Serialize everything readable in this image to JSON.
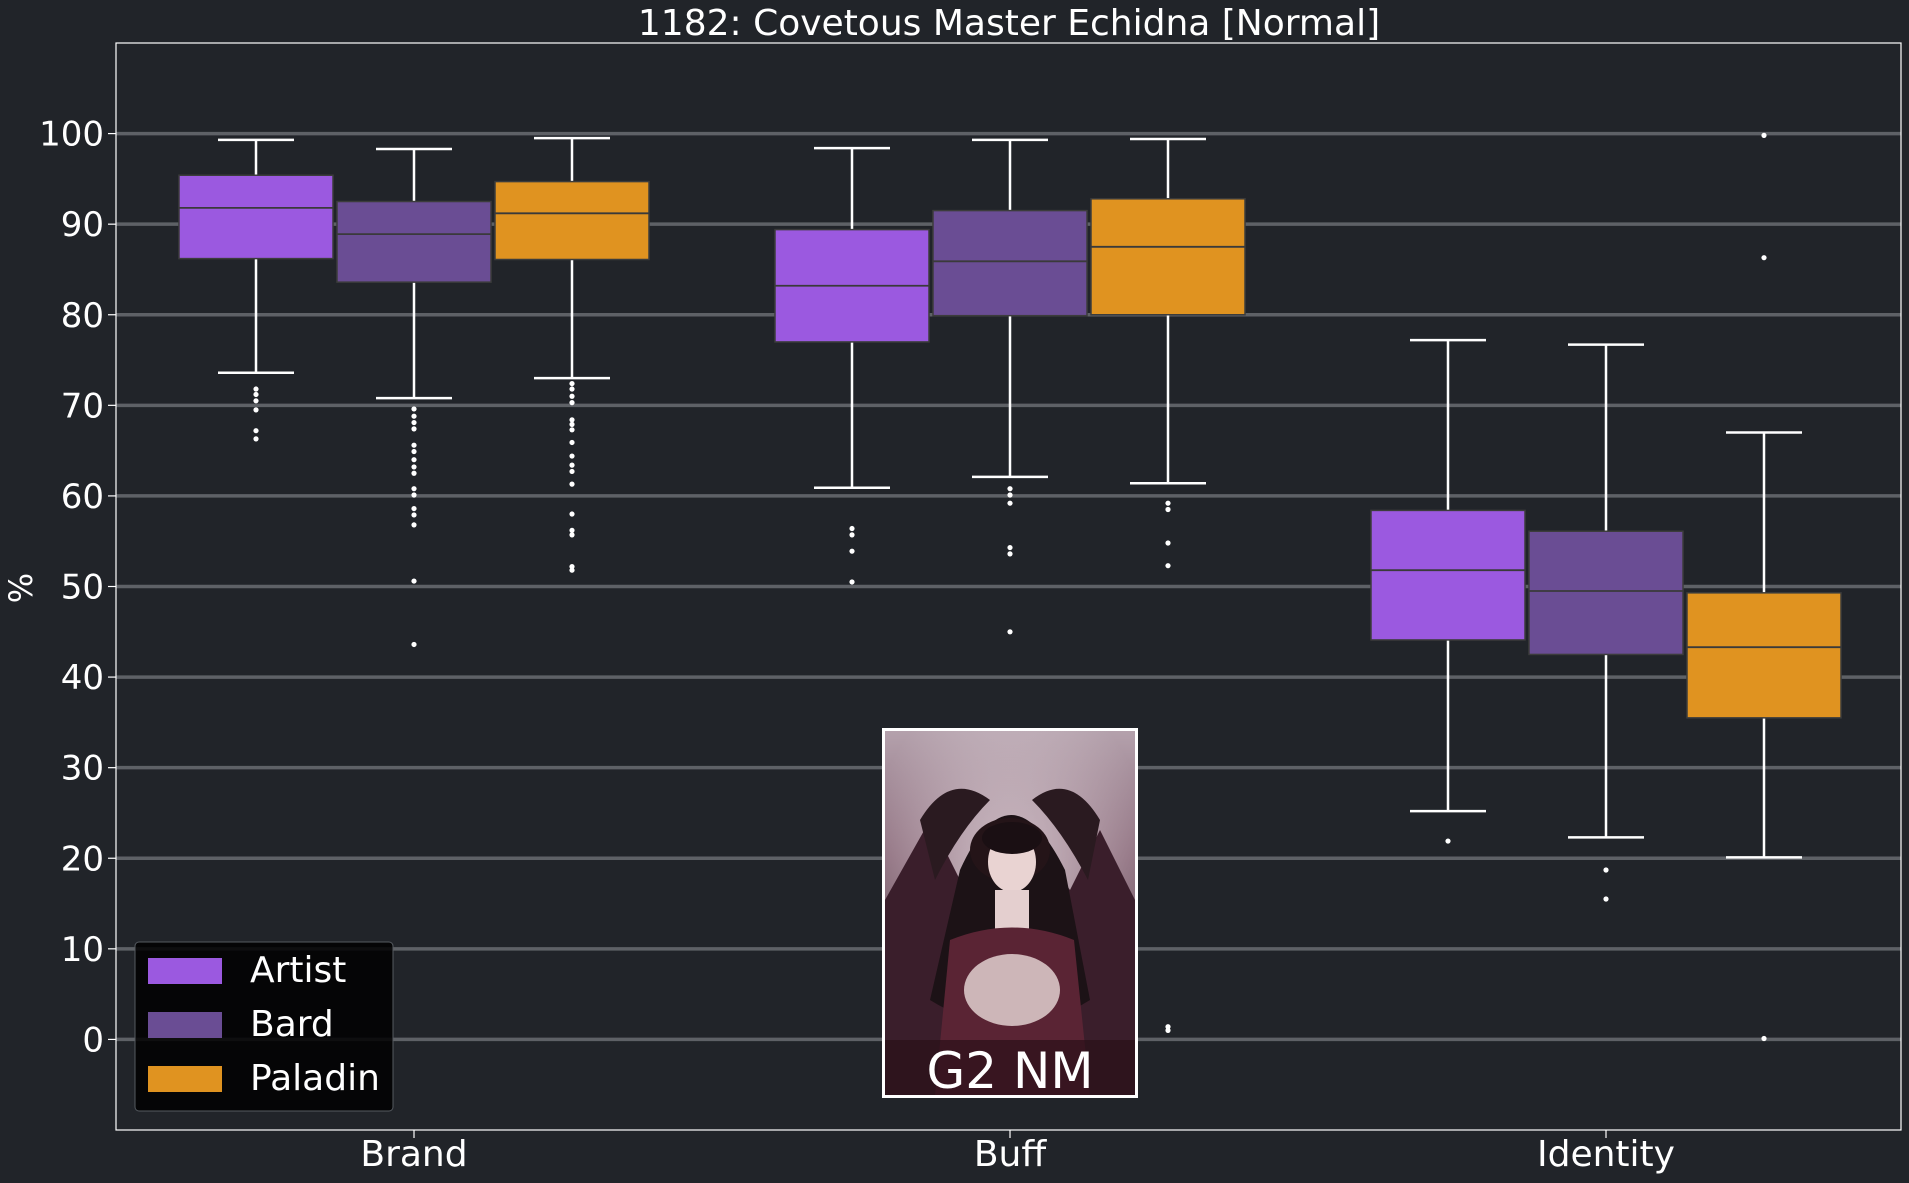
{
  "chart_data": {
    "type": "box",
    "title": "1182: Covetous Master Echidna [Normal]",
    "xlabel": "",
    "ylabel": "%",
    "ylim": [
      -10,
      110
    ],
    "yticks": [
      0,
      10,
      20,
      30,
      40,
      50,
      60,
      70,
      80,
      90,
      100
    ],
    "categories": [
      "Brand",
      "Buff",
      "Identity"
    ],
    "grid": "horizontal",
    "legend_position": "bottom-left",
    "series": [
      {
        "name": "Artist",
        "color": "#9b59e0",
        "boxes": [
          {
            "whisker_low": 73.6,
            "q1": 86.2,
            "median": 91.8,
            "q3": 95.4,
            "whisker_high": 99.3,
            "outliers": [
              71.8,
              71.2,
              70.5,
              69.5,
              67.2,
              66.3
            ]
          },
          {
            "whisker_low": 60.9,
            "q1": 77.0,
            "median": 83.2,
            "q3": 89.4,
            "whisker_high": 98.4,
            "outliers": [
              56.4,
              55.7,
              53.9,
              50.5
            ]
          },
          {
            "whisker_low": 25.2,
            "q1": 44.1,
            "median": 51.8,
            "q3": 58.4,
            "whisker_high": 77.2,
            "outliers": [
              21.9
            ]
          }
        ]
      },
      {
        "name": "Bard",
        "color": "#6a4d94",
        "boxes": [
          {
            "whisker_low": 70.8,
            "q1": 83.6,
            "median": 88.9,
            "q3": 92.5,
            "whisker_high": 98.3,
            "outliers": [
              69.6,
              68.8,
              68.1,
              67.4,
              65.6,
              64.9,
              64.0,
              63.2,
              62.5,
              60.8,
              60.1,
              58.6,
              57.9,
              56.8,
              50.6,
              43.6
            ]
          },
          {
            "whisker_low": 62.1,
            "q1": 79.9,
            "median": 85.9,
            "q3": 91.5,
            "whisker_high": 99.3,
            "outliers": [
              60.8,
              60.1,
              59.2,
              54.3,
              53.6,
              45.0
            ]
          },
          {
            "whisker_low": 22.3,
            "q1": 42.5,
            "median": 49.5,
            "q3": 56.1,
            "whisker_high": 76.7,
            "outliers": [
              18.7,
              15.5
            ]
          }
        ]
      },
      {
        "name": "Paladin",
        "color": "#e09320",
        "boxes": [
          {
            "whisker_low": 73.0,
            "q1": 86.1,
            "median": 91.2,
            "q3": 94.7,
            "whisker_high": 99.5,
            "outliers": [
              72.4,
              71.8,
              71.0,
              70.3,
              68.4,
              67.9,
              67.3,
              65.9,
              64.4,
              63.4,
              62.7,
              61.3,
              58.0,
              56.2,
              55.7,
              52.2,
              51.8
            ]
          },
          {
            "whisker_low": 61.4,
            "q1": 80.0,
            "median": 87.5,
            "q3": 92.8,
            "whisker_high": 99.4,
            "outliers": [
              59.2,
              58.5,
              54.8,
              52.3,
              1.4,
              1.0
            ]
          },
          {
            "whisker_low": 20.1,
            "q1": 35.5,
            "median": 43.3,
            "q3": 49.3,
            "whisker_high": 67.0,
            "outliers": [
              99.8,
              86.3,
              0.1
            ]
          }
        ]
      }
    ],
    "inset_image": {
      "caption": "G2 NM"
    }
  }
}
